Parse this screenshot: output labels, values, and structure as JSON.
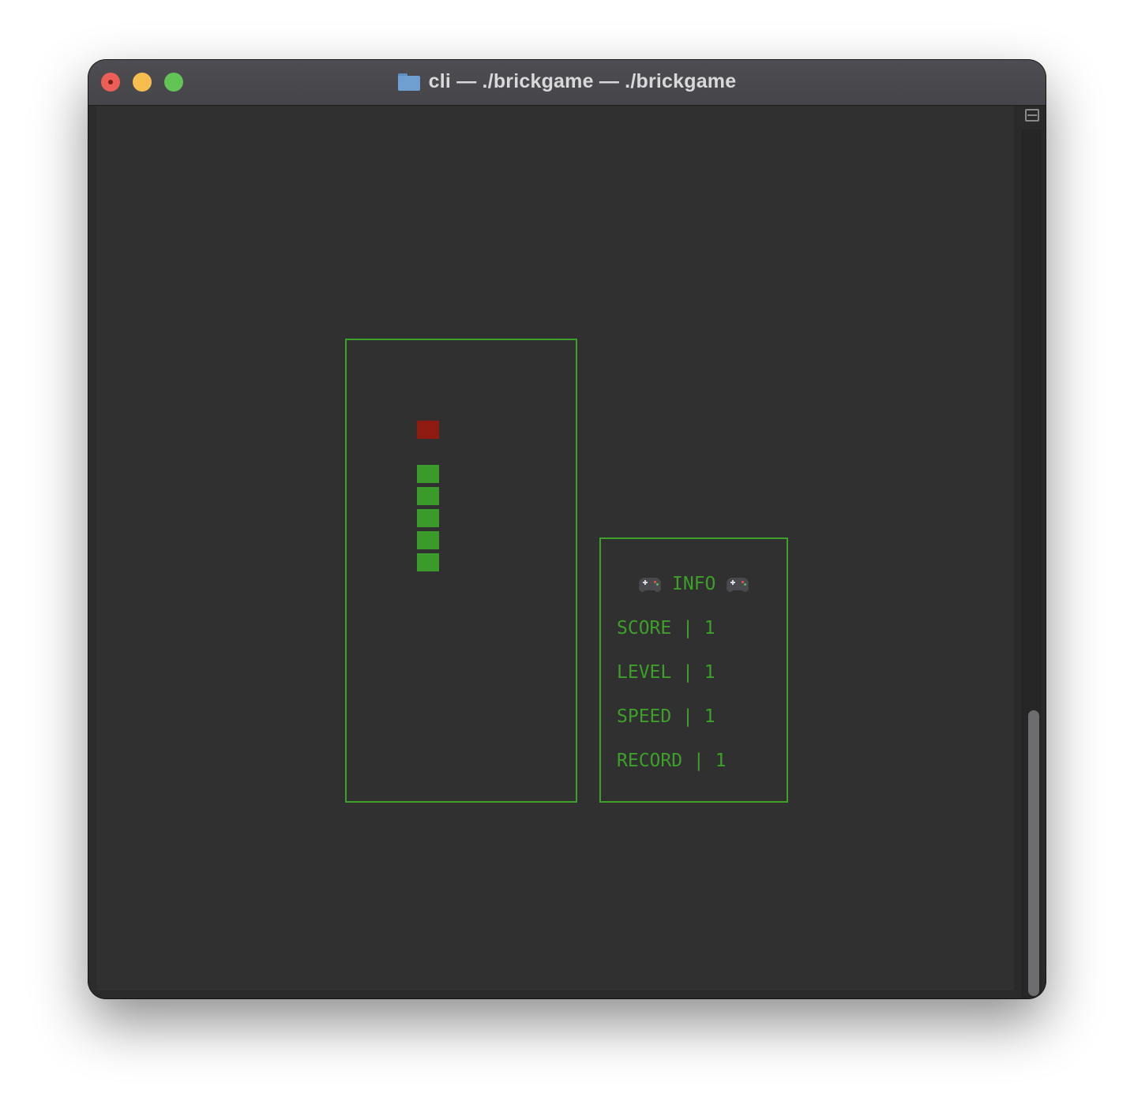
{
  "window": {
    "title": "cli — ./brickgame — ./brickgame"
  },
  "game": {
    "field_rows": 21,
    "field_cols": 10,
    "food": {
      "row": 3,
      "col": 3
    },
    "snake": [
      {
        "row": 5,
        "col": 3
      },
      {
        "row": 6,
        "col": 3
      },
      {
        "row": 7,
        "col": 3
      },
      {
        "row": 8,
        "col": 3
      },
      {
        "row": 9,
        "col": 3
      }
    ]
  },
  "info": {
    "title": "INFO",
    "score_line": "SCORE | 1",
    "level_line": "LEVEL | 1",
    "speed_line": "SPEED | 1",
    "record_line": "RECORD | 1"
  },
  "colors": {
    "accent": "#3e9f2a",
    "food": "#8e1a12",
    "terminal_bg": "#303030"
  },
  "icons": {
    "title_folder": "folder-icon",
    "info_decoration": "gamepad-icon",
    "split": "split-pane-icon"
  }
}
